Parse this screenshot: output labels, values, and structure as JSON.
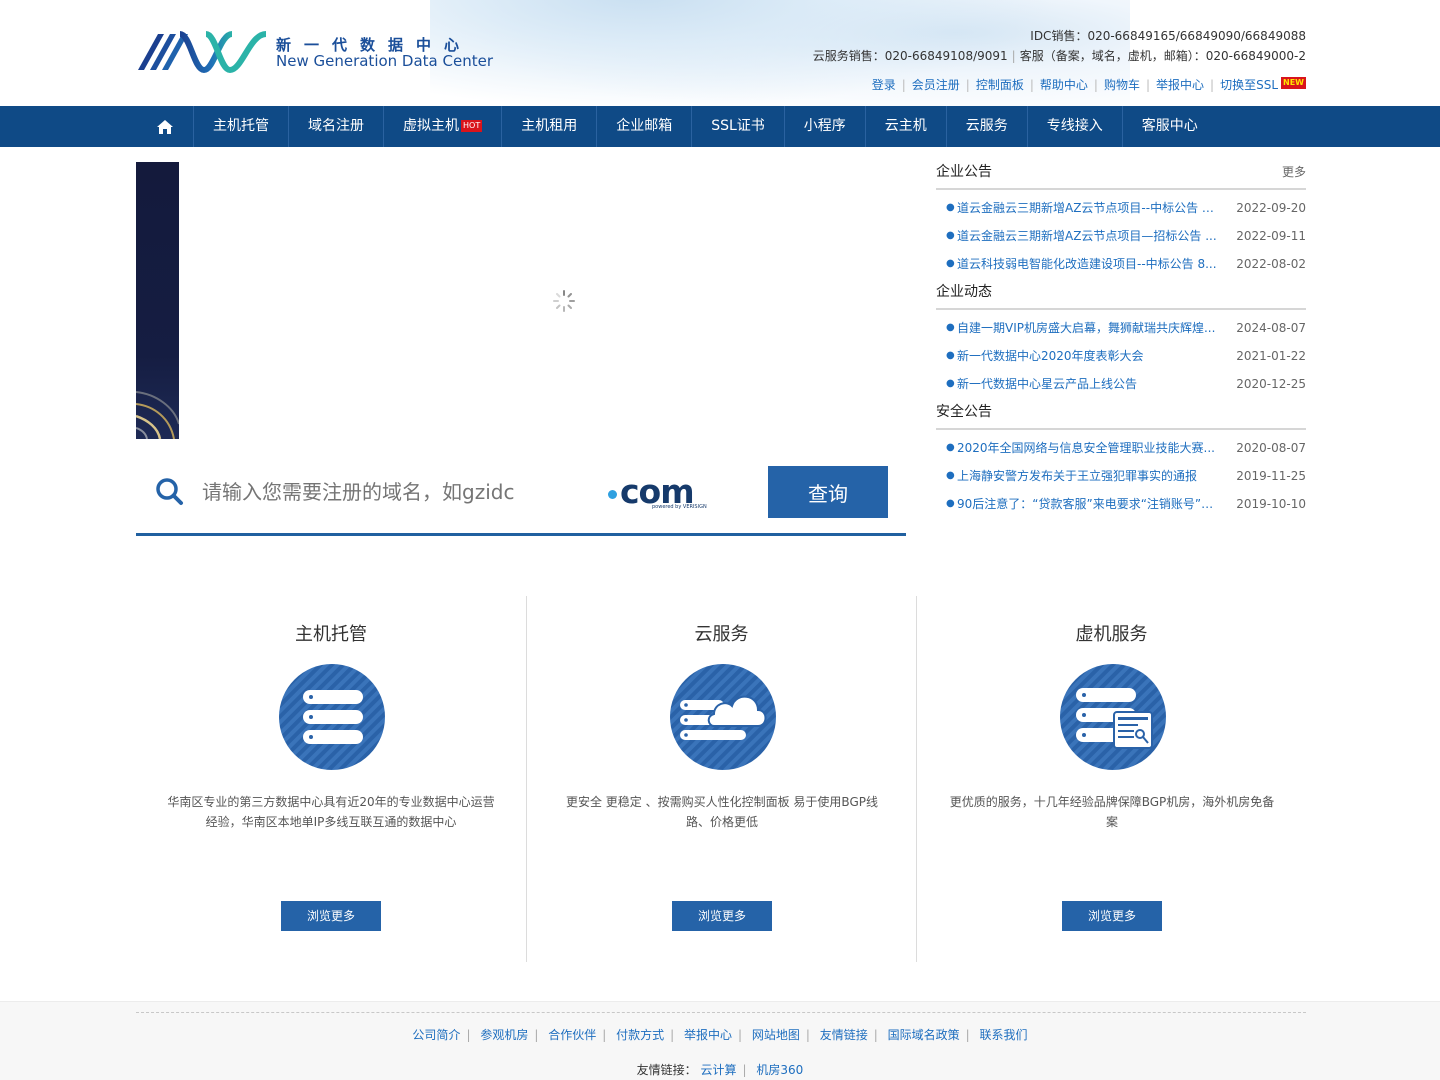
{
  "header": {
    "logo_cn": "新一代数据中心",
    "logo_en": "New Generation Data Center",
    "idc_sales": "IDC销售：020-66849165/66849090/66849088",
    "cloud_sales": "云服务销售：020-66849108/9091",
    "support": "客服（备案，域名，虚机，邮箱）：020-66849000-2",
    "links": [
      "登录",
      "会员注册",
      "控制面板",
      "帮助中心",
      "购物车",
      "举报中心",
      "切换至SSL"
    ],
    "new_badge": "NEW"
  },
  "nav": {
    "items": [
      "主机托管",
      "域名注册",
      "虚拟主机",
      "主机租用",
      "企业邮箱",
      "SSL证书",
      "小程序",
      "云主机",
      "云服务",
      "专线接入",
      "客服中心"
    ],
    "hot_badge": "HOT"
  },
  "search": {
    "placeholder": "请输入您需要注册的域名，如gzidc",
    "tld": "com",
    "tld_sub": "powered by VERISIGN",
    "button": "查询"
  },
  "news": [
    {
      "title": "企业公告",
      "more": "更多",
      "items": [
        {
          "title": "道云金融云三期新增AZ云节点项目--中标公告 9...",
          "date": "2022-09-20"
        },
        {
          "title": "道云金融云三期新增AZ云节点项目—招标公告 ...",
          "date": "2022-09-11"
        },
        {
          "title": "道云科技弱电智能化改造建设项目--中标公告 8...",
          "date": "2022-08-02"
        }
      ]
    },
    {
      "title": "企业动态",
      "more": "",
      "items": [
        {
          "title": "自建一期VIP机房盛大启幕，舞狮献瑞共庆辉煌...",
          "date": "2024-08-07"
        },
        {
          "title": "新一代数据中心2020年度表彰大会",
          "date": "2021-01-22"
        },
        {
          "title": "新一代数据中心星云产品上线公告",
          "date": "2020-12-25"
        }
      ]
    },
    {
      "title": "安全公告",
      "more": "",
      "items": [
        {
          "title": "2020年全国网络与信息安全管理职业技能大赛...",
          "date": "2020-08-07"
        },
        {
          "title": "上海静安警方发布关于王立强犯罪事实的通报",
          "date": "2019-11-25"
        },
        {
          "title": "90后注意了：“贷款客服”来电要求“注销账号”是...",
          "date": "2019-10-10"
        }
      ]
    }
  ],
  "services": [
    {
      "title": "主机托管",
      "icon": "server-stack-icon",
      "desc": "华南区专业的第三方数据中心具有近20年的专业数据中心运营经验，华南区本地单IP多线互联互通的数据中心",
      "button": "浏览更多"
    },
    {
      "title": "云服务",
      "icon": "cloud-server-icon",
      "desc": "更安全 更稳定 、按需购买人性化控制面板 易于使用BGP线路、价格更低",
      "button": "浏览更多"
    },
    {
      "title": "虚机服务",
      "icon": "virtual-host-icon",
      "desc": "更优质的服务，十几年经验品牌保障BGP机房，海外机房免备案",
      "button": "浏览更多"
    }
  ],
  "footer": {
    "links": [
      "公司简介",
      "参观机房",
      "合作伙伴",
      "付款方式",
      "举报中心",
      "网站地图",
      "友情链接",
      "国际域名政策",
      "联系我们"
    ],
    "friends_label": "友情链接：",
    "friends": [
      "云计算",
      "机房360"
    ]
  },
  "colors": {
    "nav_bg": "#0f4a86",
    "accent": "#2563a8",
    "link": "#1e6ebf",
    "badge": "#d9141b"
  }
}
